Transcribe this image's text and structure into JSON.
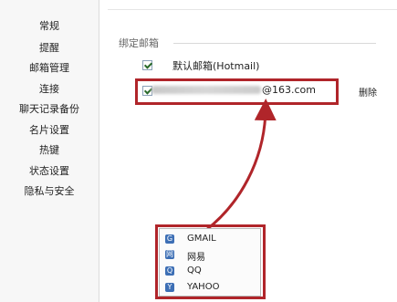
{
  "sidebar": {
    "items": [
      {
        "label": "常规"
      },
      {
        "label": "提醒"
      },
      {
        "label": "邮箱管理"
      },
      {
        "label": "连接"
      },
      {
        "label": "聊天记录备份"
      },
      {
        "label": "名片设置"
      },
      {
        "label": "热键"
      },
      {
        "label": "状态设置"
      },
      {
        "label": "隐私与安全"
      }
    ]
  },
  "main": {
    "section_title": "绑定邮箱",
    "rows": [
      {
        "label": "默认邮箱(Hotmail)",
        "checked": true
      },
      {
        "label": "@163.com",
        "checked": true,
        "action_label": "删除"
      }
    ]
  },
  "dropdown": {
    "items": [
      {
        "label": "GMAIL",
        "icon": "gmail-icon",
        "glyph": "G"
      },
      {
        "label": "网易",
        "icon": "netease-icon",
        "glyph": "网"
      },
      {
        "label": "QQ",
        "icon": "qq-icon",
        "glyph": "Q"
      },
      {
        "label": "YAHOO",
        "icon": "yahoo-icon",
        "glyph": "Y"
      }
    ]
  },
  "colors": {
    "highlight": "#b0252a",
    "icon_bg": "#3d6fb5"
  }
}
